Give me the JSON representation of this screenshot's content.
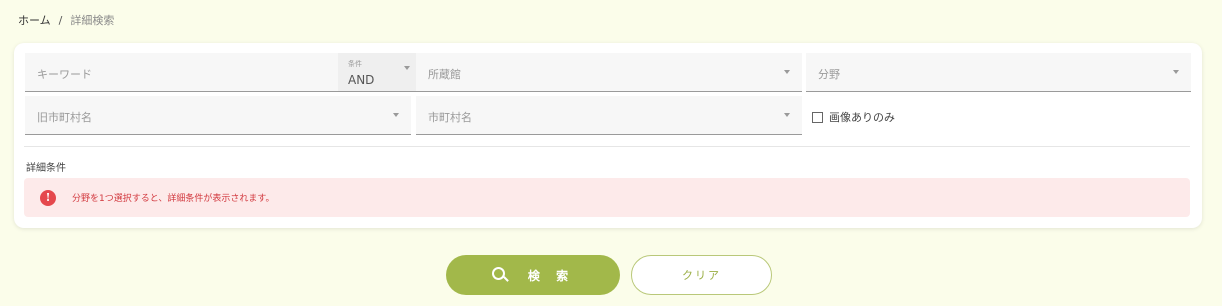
{
  "breadcrumb": {
    "home": "ホーム",
    "separator": "/",
    "current": "詳細検索"
  },
  "search_form": {
    "keyword_placeholder": "キーワード",
    "condition": {
      "label": "条件",
      "value": "AND"
    },
    "collection_placeholder": "所蔵館",
    "category_placeholder": "分野",
    "old_municipality_placeholder": "旧市町村名",
    "municipality_placeholder": "市町村名",
    "images_only_label": "画像ありのみ",
    "images_only_checked": false
  },
  "details": {
    "title": "詳細条件",
    "notice": "分野を1つ選択すると、詳細条件が表示されます。",
    "notice_icon": "info-icon"
  },
  "actions": {
    "search_label": "検 索",
    "search_icon": "search-icon",
    "clear_label": "クリア"
  },
  "colors": {
    "page_background": "#fbfdea",
    "accent": "#a2b84a",
    "notice_background": "#fdeaea",
    "notice_text": "#d2393f"
  }
}
